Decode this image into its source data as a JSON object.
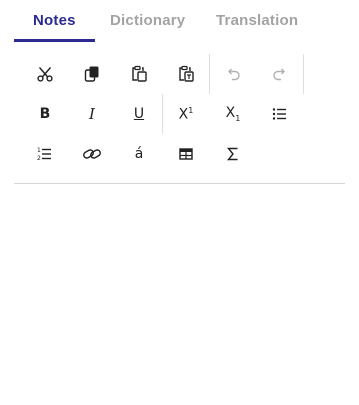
{
  "tabs": [
    {
      "label": "Notes",
      "active": true
    },
    {
      "label": "Dictionary",
      "active": false
    },
    {
      "label": "Translation",
      "active": false
    }
  ],
  "toolbar": {
    "row1": [
      "scissors-icon",
      "copy-icon",
      "paste-icon",
      "paste-text-icon",
      "undo-icon",
      "redo-icon"
    ],
    "row2": {
      "bold": "B",
      "italic": "I",
      "underline": "U",
      "superscript_base": "X",
      "superscript_mark": "1",
      "subscript_base": "X",
      "subscript_mark": "1"
    },
    "row3": {
      "special_char": "á"
    },
    "disabled": [
      "undo-icon",
      "redo-icon"
    ]
  },
  "colors": {
    "accent": "#2b2a8f",
    "inactive_tab": "#a3a3a3",
    "icon": "#222222",
    "separator": "#dedede"
  },
  "editor": {
    "content": ""
  }
}
